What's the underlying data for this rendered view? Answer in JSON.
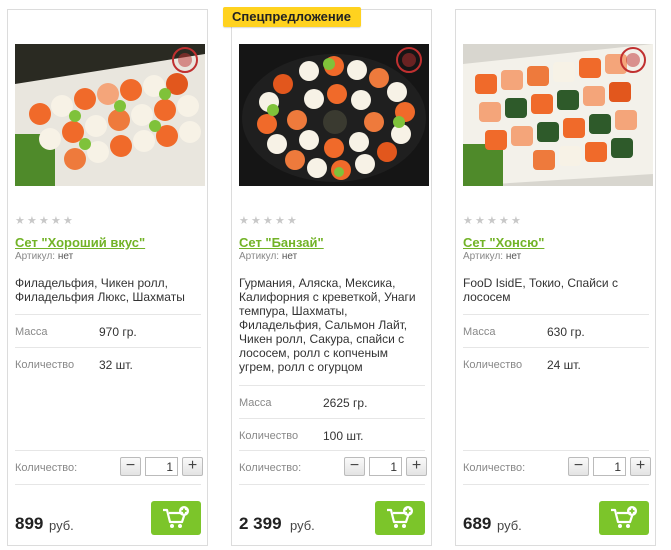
{
  "currency": "руб.",
  "quantity_label": "Количество:",
  "mass_label": "Масса",
  "count_label": "Количество",
  "article_label": "Артикул:",
  "colors": {
    "accent_green": "#72b327",
    "cart_green": "#7cc52a",
    "badge_yellow": "#ffd21f"
  },
  "products": [
    {
      "badge": "",
      "title": "Сет \"Хороший вкус\"",
      "article": "нет",
      "rating": 0,
      "description": "Филадельфия, Чикен ролл, Филадельфия Люкс, Шахматы",
      "mass": "970 гр.",
      "count": "32 шт.",
      "quantity": "1",
      "price": "899"
    },
    {
      "badge": "Спецпредложение",
      "title": "Сет \"Банзай\"",
      "article": "нет",
      "rating": 0,
      "description": "Гурмания, Аляска, Мексика, Калифорния с креветкой, Унаги темпура, Шахматы, Филадельфия, Сальмон Лайт, Чикен ролл, Сакура, спайси с лососем, ролл с копченым угрем, ролл с огурцом",
      "mass": "2625 гр.",
      "count": "100 шт.",
      "quantity": "1",
      "price": "2 399"
    },
    {
      "badge": "",
      "title": "Сет \"Хонсю\"",
      "article": "нет",
      "rating": 0,
      "description": "FooD IsidE, Токио, Спайси с лососем",
      "mass": "630 гр.",
      "count": "24 шт.",
      "quantity": "1",
      "price": "689"
    }
  ]
}
